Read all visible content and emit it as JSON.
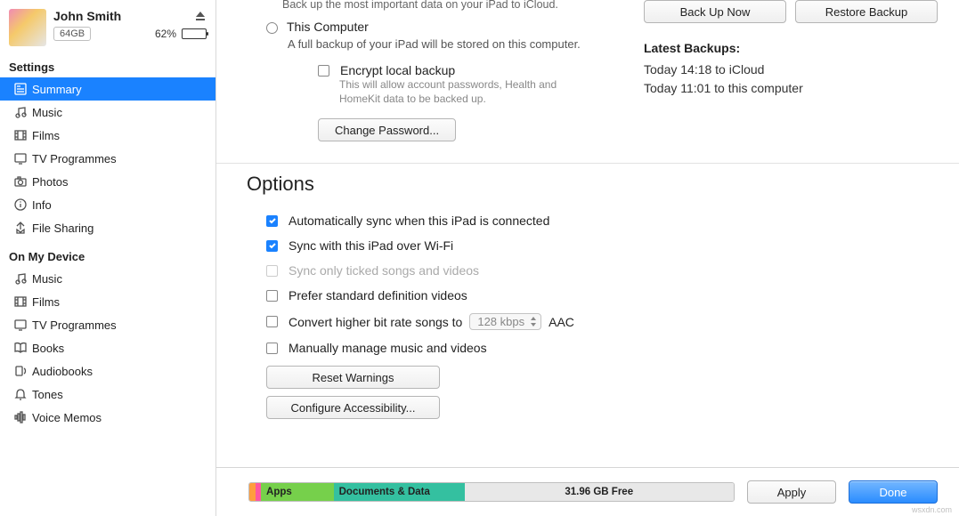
{
  "device": {
    "name": "John Smith",
    "capacity": "64GB",
    "battery_pct": "62%",
    "battery_fill": 62
  },
  "sidebar": {
    "settings_hdr": "Settings",
    "settings": [
      {
        "id": "summary",
        "label": "Summary",
        "icon": "summary"
      },
      {
        "id": "music",
        "label": "Music",
        "icon": "music"
      },
      {
        "id": "films",
        "label": "Films",
        "icon": "film"
      },
      {
        "id": "tv",
        "label": "TV Programmes",
        "icon": "tv"
      },
      {
        "id": "photos",
        "label": "Photos",
        "icon": "camera"
      },
      {
        "id": "info",
        "label": "Info",
        "icon": "info"
      },
      {
        "id": "filesharing",
        "label": "File Sharing",
        "icon": "share"
      }
    ],
    "device_hdr": "On My Device",
    "device_items": [
      {
        "id": "d-music",
        "label": "Music",
        "icon": "music"
      },
      {
        "id": "d-films",
        "label": "Films",
        "icon": "film"
      },
      {
        "id": "d-tv",
        "label": "TV Programmes",
        "icon": "tv"
      },
      {
        "id": "d-books",
        "label": "Books",
        "icon": "book"
      },
      {
        "id": "d-audio",
        "label": "Audiobooks",
        "icon": "audiobook"
      },
      {
        "id": "d-tones",
        "label": "Tones",
        "icon": "bell"
      },
      {
        "id": "d-memos",
        "label": "Voice Memos",
        "icon": "memo"
      }
    ]
  },
  "backup": {
    "top_desc": "Back up the most important data on your iPad to iCloud.",
    "this_computer": "This Computer",
    "this_computer_desc": "A full backup of your iPad will be stored on this computer.",
    "encrypt": "Encrypt local backup",
    "encrypt_desc": "This will allow account passwords, Health and HomeKit data to be backed up.",
    "change_pw": "Change Password...",
    "back_up_now": "Back Up Now",
    "restore": "Restore Backup",
    "latest_hdr": "Latest Backups:",
    "latest1": "Today 14:18 to iCloud",
    "latest2": "Today 11:01 to this computer"
  },
  "options": {
    "title": "Options",
    "auto_sync": "Automatically sync when this iPad is connected",
    "wifi_sync": "Sync with this iPad over Wi-Fi",
    "ticked_only": "Sync only ticked songs and videos",
    "sd_video": "Prefer standard definition videos",
    "convert": "Convert higher bit rate songs to",
    "bitrate": "128 kbps",
    "aac": "AAC",
    "manual": "Manually manage music and videos",
    "reset": "Reset Warnings",
    "configure": "Configure Accessibility..."
  },
  "footer": {
    "apps": "Apps",
    "docs": "Documents & Data",
    "free": "31.96 GB Free",
    "apply": "Apply",
    "done": "Done"
  },
  "watermark": "wsxdn.com"
}
